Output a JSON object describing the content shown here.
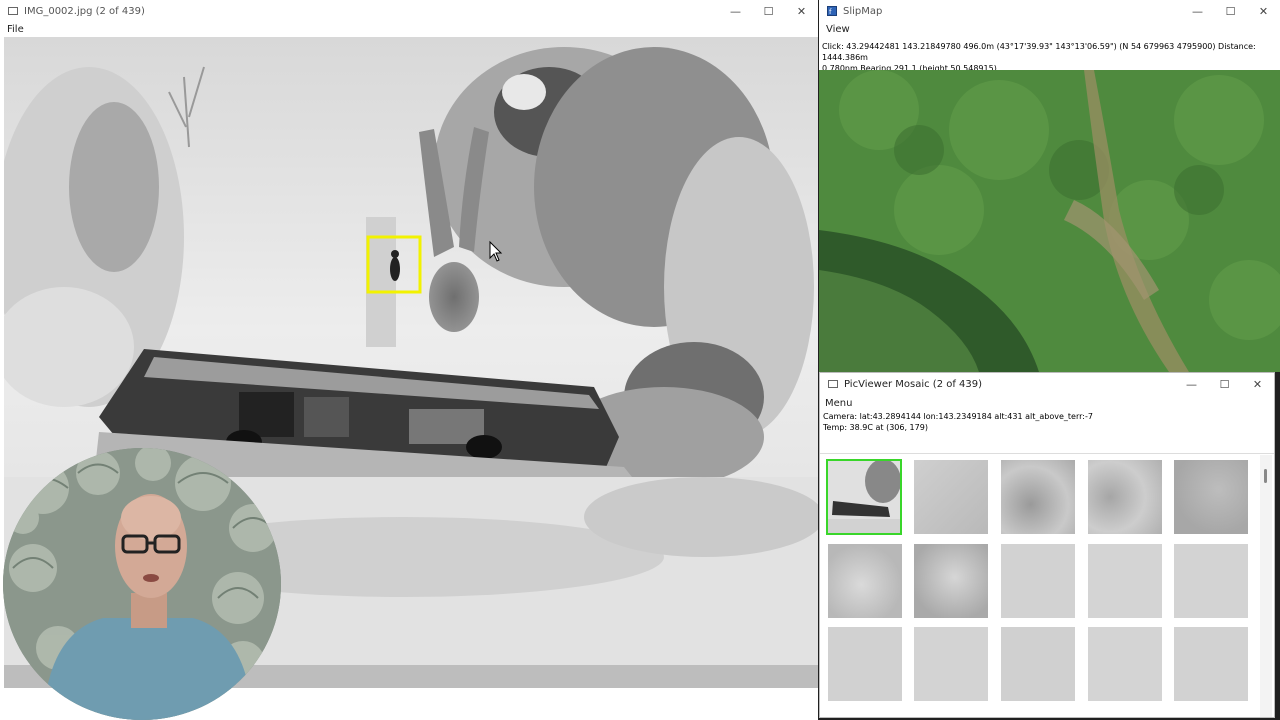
{
  "image_window": {
    "title": "IMG_0002.jpg (2 of 439)",
    "menu": [
      "File"
    ]
  },
  "slipmap": {
    "title": "SlipMap",
    "menu": [
      "View"
    ],
    "status_line1": "Click: 43.29442481 143.21849780  496.0m (43°17'39.93\" 143°13'06.59\") (N 54 679963 4795900)  Distance: 1444.386m",
    "status_line2": "0.780nm Bearing 291.1 (height 50.548915)"
  },
  "mosaic": {
    "title": "PicViewer Mosaic (2 of 439)",
    "menu": [
      "Menu"
    ],
    "camera_line": "Camera: lat:43.2894144 lon:143.2349184 alt:431 alt_above_terr:-7",
    "temp_line": "Temp: 38.9C at (306, 179)",
    "thumbnail_count": 15
  },
  "colors": {
    "selected_thumb_border": "#39d62a",
    "target_box": "#f2f200",
    "map_green": "#4f8a3e"
  },
  "icons": [
    "minimize-icon",
    "maximize-icon",
    "close-icon",
    "app-icon",
    "mouse-cursor-icon"
  ]
}
